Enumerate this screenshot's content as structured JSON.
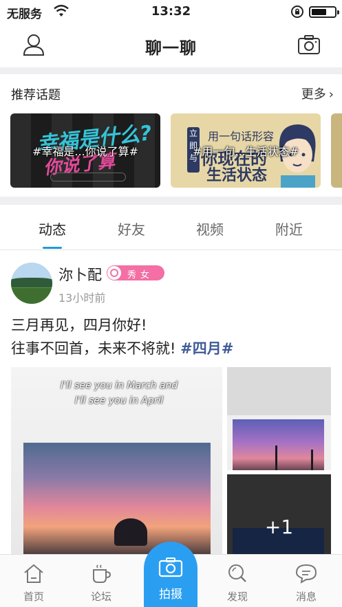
{
  "status_bar": {
    "carrier": "无服务",
    "time": "13:32",
    "icons": [
      "wifi-icon",
      "rotation-lock-icon",
      "battery-icon"
    ]
  },
  "nav": {
    "title": "聊一聊",
    "left_icon": "user-icon",
    "right_icon": "camera-icon"
  },
  "topics": {
    "label": "推荐话题",
    "more": "更多",
    "cards": [
      {
        "overlay": "#幸福是...你说了算#",
        "art_line1": "幸福是什么?",
        "art_line2": "你说了算"
      },
      {
        "overlay": "#用一句...生活状态#",
        "art_vertical": "立即与",
        "art_line1": "用一句话形容",
        "art_line2": "你现在的",
        "art_line3": "生活状态"
      }
    ]
  },
  "tabs": {
    "items": [
      "动态",
      "好友",
      "视频",
      "附近"
    ],
    "active_index": 0
  },
  "post": {
    "username": "沵卜配",
    "badge": "秀女",
    "time": "13小时前",
    "text_line1": "三月再见，四月你好!",
    "text_line2": "往事不回首，未来不将就!",
    "hashtag": "#四月#",
    "image_main_caption": "I'll see you in March and I'll see you in April",
    "image_side1_caption": "",
    "image_side2_caption": "",
    "more_count": "+1"
  },
  "tabbar": {
    "items": [
      {
        "label": "首页",
        "icon": "home-icon"
      },
      {
        "label": "论坛",
        "icon": "coffee-cup-icon"
      },
      {
        "label": "拍摄",
        "icon": "camera-icon"
      },
      {
        "label": "发现",
        "icon": "search-icon"
      },
      {
        "label": "消息",
        "icon": "chat-bubble-icon"
      }
    ]
  },
  "colors": {
    "accent_blue": "#2a9ff2",
    "tab_indicator": "#1e9bd7",
    "hashtag": "#3e5a96",
    "badge_pink": "#f36fa5",
    "divider_gray": "#efeff1"
  }
}
